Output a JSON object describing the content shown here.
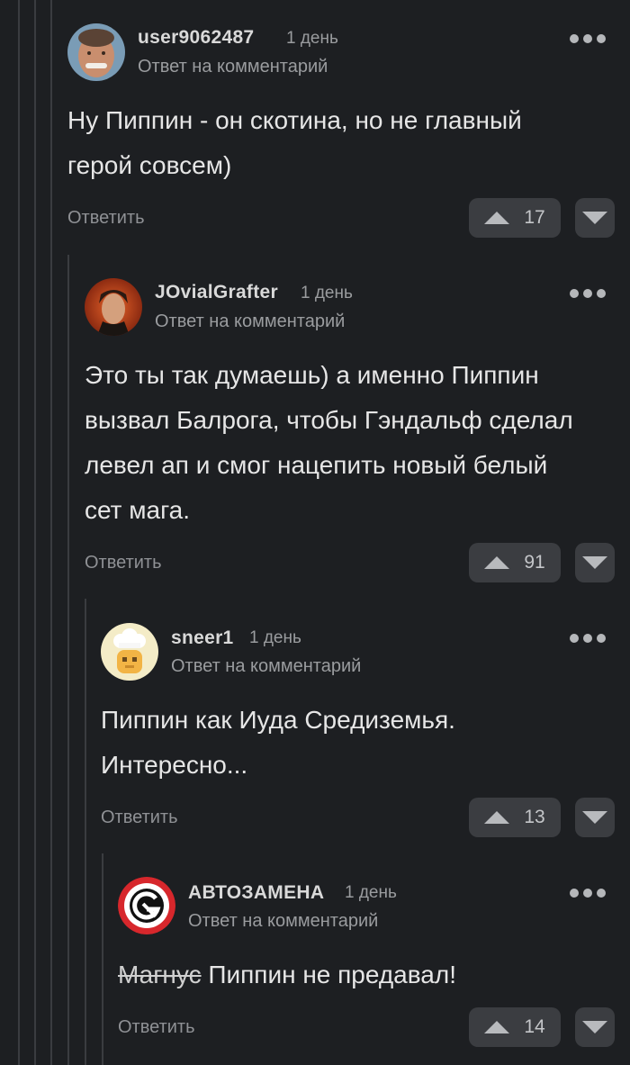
{
  "comments": [
    {
      "username": "user9062487",
      "time": "1 день",
      "reply_to": "Ответ на комментарий",
      "text_lines": [
        "Ну Пиппин - он скотина, но не главный",
        "герой совсем)"
      ],
      "answer_label": "Ответить",
      "rating": "17",
      "avatar_icon": "user-photo-avatar"
    },
    {
      "username": "JOvialGrafter",
      "time": "1 день",
      "reply_to": "Ответ на комментарий",
      "text_lines": [
        "Это ты так думаешь) а именно Пиппин",
        "вызвал Балрога, чтобы Гэндальф сделал",
        "левел ап и смог нацепить новый белый",
        "сет мага."
      ],
      "answer_label": "Ответить",
      "rating": "91",
      "avatar_icon": "user-photo-avatar"
    },
    {
      "username": "sneer1",
      "time": "1 день",
      "reply_to": "Ответ на комментарий",
      "text_lines": [
        "Пиппин как Иуда Средиземья.",
        "Интересно..."
      ],
      "answer_label": "Ответить",
      "rating": "13",
      "avatar_icon": "cartoon-chef-avatar"
    },
    {
      "username": "АВТОЗАМЕНА",
      "time": "1 день",
      "reply_to": "Ответ на комментарий",
      "strike_word": "Магнус",
      "text_rest": " Пиппин не предавал!",
      "answer_label": "Ответить",
      "rating": "14",
      "avatar_icon": "g-logo-avatar"
    }
  ],
  "colors": {
    "background": "#1d1f22",
    "thread_line": "#3a3c40",
    "button_bg": "#3b3d41"
  }
}
